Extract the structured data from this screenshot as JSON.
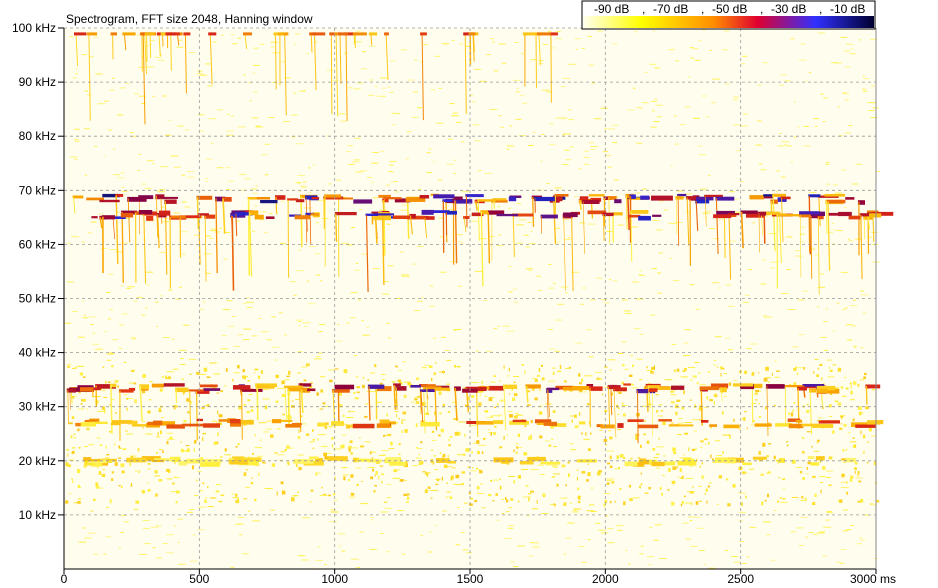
{
  "chart_data": {
    "type": "heatmap",
    "title": "Spectrogram, FFT size 2048, Hanning window",
    "xlabel": "",
    "ylabel": "",
    "x_unit": "ms",
    "y_unit": "kHz",
    "xlim": [
      0,
      3000
    ],
    "ylim": [
      0,
      100
    ],
    "x_ticks": [
      0,
      500,
      1000,
      1500,
      2000,
      2500,
      3000
    ],
    "x_tick_labels": [
      "0",
      "500",
      "1000",
      "1500",
      "2000",
      "2500",
      "3000 ms"
    ],
    "y_ticks": [
      10,
      20,
      30,
      40,
      50,
      60,
      70,
      80,
      90,
      100
    ],
    "y_tick_labels": [
      "10 kHz",
      "20 kHz",
      "30 kHz",
      "40 kHz",
      "50 kHz",
      "60 kHz",
      "70 kHz",
      "80 kHz",
      "90 kHz",
      "100 kHz"
    ],
    "grid": true,
    "colorbar": {
      "placement": "top-right",
      "labels": [
        "-90 dB",
        "-70 dB",
        "-50 dB",
        "-30 dB",
        "-10 dB"
      ],
      "colors": [
        "#ffffff",
        "#ffff00",
        "#ff0000",
        "#0000ff",
        "#000000"
      ]
    },
    "bands": [
      {
        "freq_khz": 68.5,
        "intensity": 0.85
      },
      {
        "freq_khz": 65.5,
        "intensity": 0.8
      },
      {
        "freq_khz": 33.5,
        "intensity": 0.75
      },
      {
        "freq_khz": 27.0,
        "intensity": 0.55
      },
      {
        "freq_khz": 20.0,
        "intensity": 0.35
      }
    ]
  }
}
